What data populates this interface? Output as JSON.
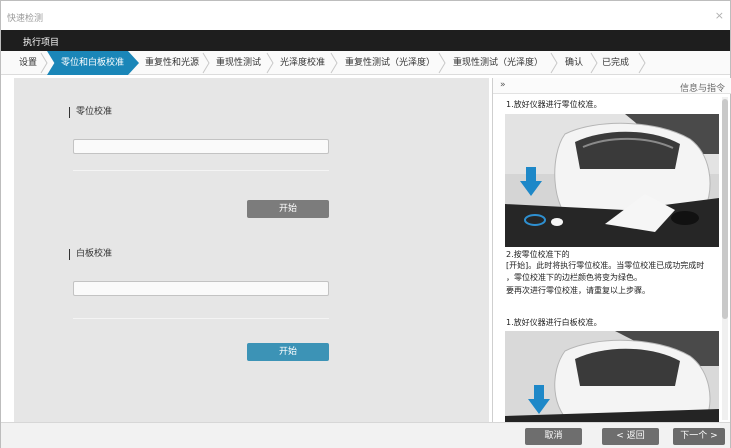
{
  "window": {
    "title": "快速检测",
    "close_glyph": "×"
  },
  "menu": {
    "item": "执行项目"
  },
  "steps": [
    {
      "label": "设置"
    },
    {
      "label": "零位和白板校准"
    },
    {
      "label": "重复性和光源"
    },
    {
      "label": "重现性测试"
    },
    {
      "label": "光泽度校准"
    },
    {
      "label": "重复性测试（光泽度）"
    },
    {
      "label": "重现性测试（光泽度）"
    },
    {
      "label": "确认"
    },
    {
      "label": "已完成"
    }
  ],
  "active_step": "零位和白板校准",
  "zero_cal": {
    "label": "零位校准",
    "button": "开始"
  },
  "white_cal": {
    "label": "白板校准",
    "button": "开始"
  },
  "help": {
    "toggle": "»",
    "title": "信息与指令",
    "step1": "1.放好仪器进行零位校准。",
    "step2_title": "2.按零位校准下的",
    "step2_line1": "[开始]。此时将执行零位校准。当零位校准已成功完成时",
    "step2_line2": "，零位校准下的边栏颜色将变为绿色。",
    "step2_line3": "要再次进行零位校准，请重复以上步骤。",
    "step3": "1.放好仪器进行白板校准。"
  },
  "footer": {
    "cancel": "取消",
    "back": "< 返回",
    "next": "下一个 >"
  },
  "colors": {
    "accent": "#1a86b8",
    "start_active": "#3c93b6",
    "start_disabled": "#7c7c7c",
    "menubar": "#1e1e1e"
  },
  "icons": {
    "arrow": "down-arrow-icon",
    "device": "colorimeter-device-image"
  }
}
